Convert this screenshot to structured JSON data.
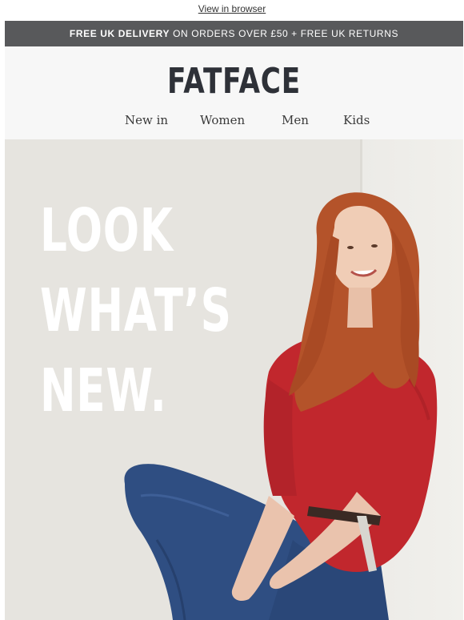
{
  "top_link": {
    "label": "View in browser"
  },
  "promo": {
    "bold_text": "FREE UK DELIVERY",
    "rest_text": "ON ORDERS OVER £50 + FREE UK RETURNS"
  },
  "brand": {
    "logo_text": "FATFACE"
  },
  "nav": {
    "items": [
      {
        "label": "New in"
      },
      {
        "label": "Women"
      },
      {
        "label": "Men"
      },
      {
        "label": "Kids"
      }
    ]
  },
  "hero": {
    "headline_lines": [
      "LOOK",
      "WHAT’S",
      "NEW."
    ]
  },
  "colors": {
    "promo_bg": "#58595b",
    "header_bg": "#f7f7f7",
    "hero_bg": "#e6e4df",
    "logo": "#2e3138",
    "top_red": "#c1272d",
    "jeans_blue": "#2f4e82",
    "hair_copper": "#b4532a"
  }
}
